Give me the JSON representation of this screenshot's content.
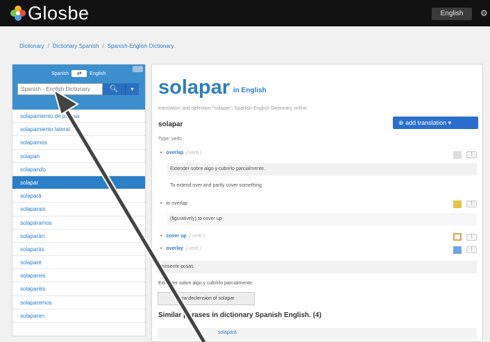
{
  "header": {
    "logo_text": "Glosbe",
    "language_button": "English",
    "settings_icon": "gear-icon"
  },
  "breadcrumb": {
    "items": [
      "Dictionary",
      "Dictionary Spanish",
      "Spanish-English Dictionary"
    ],
    "separator": "/"
  },
  "sidebar": {
    "from_lang": "Spanish",
    "to_lang": "English",
    "swap_icon": "swap-icon",
    "search_placeholder": "Spanish - English Dictionary",
    "search_icon": "search-icon",
    "dropdown_icon": "chevron-down-icon",
    "items": [
      "solapamiento de prensa",
      "solapamiento lateral",
      "solapamos",
      "solapan",
      "solapando",
      "solapar",
      "solapará",
      "solaparais",
      "solapáramos",
      "solaparán",
      "solaparás",
      "solaparé",
      "solapareis",
      "solaparéis",
      "solaparemos",
      "solaparen"
    ],
    "active_index": 5
  },
  "main": {
    "word": "solapar",
    "in_language": "in English",
    "subtitle": "translation and definition \"solapar\", Spanish-English Dictionary  online",
    "heading": "solapar",
    "add_translation": "add translation",
    "type_label": "Type: verb;",
    "translations": [
      {
        "term": "overlap",
        "pos": "{ verb }"
      },
      {
        "term": "to overlap",
        "pos": ""
      },
      {
        "term": "cover up",
        "pos": "{ verb }"
      },
      {
        "term": "overlay",
        "pos": "{ verb }"
      }
    ],
    "examples": {
      "overlap_es": "Extender sobre algo y cubrirlo parcialmente.",
      "overlap_en": "To extend over and partly cover something.",
      "to_overlap_note": "(figuratively) to cover up"
    },
    "consentir": "consentir cosas",
    "extender": "Extender sobre algo y cubrirlo parcialmente.",
    "declension_button": "Show declension of solapar",
    "similar_heading": "Similar phrases in dictionary Spanish English. (4)",
    "similar_first": "solapará",
    "mini_button": "⋮"
  },
  "colors": {
    "accent": "#2f7ec4",
    "topbar": "#111111",
    "sidebar_header": "#3b8fcd",
    "button_blue": "#2a6fcc"
  }
}
